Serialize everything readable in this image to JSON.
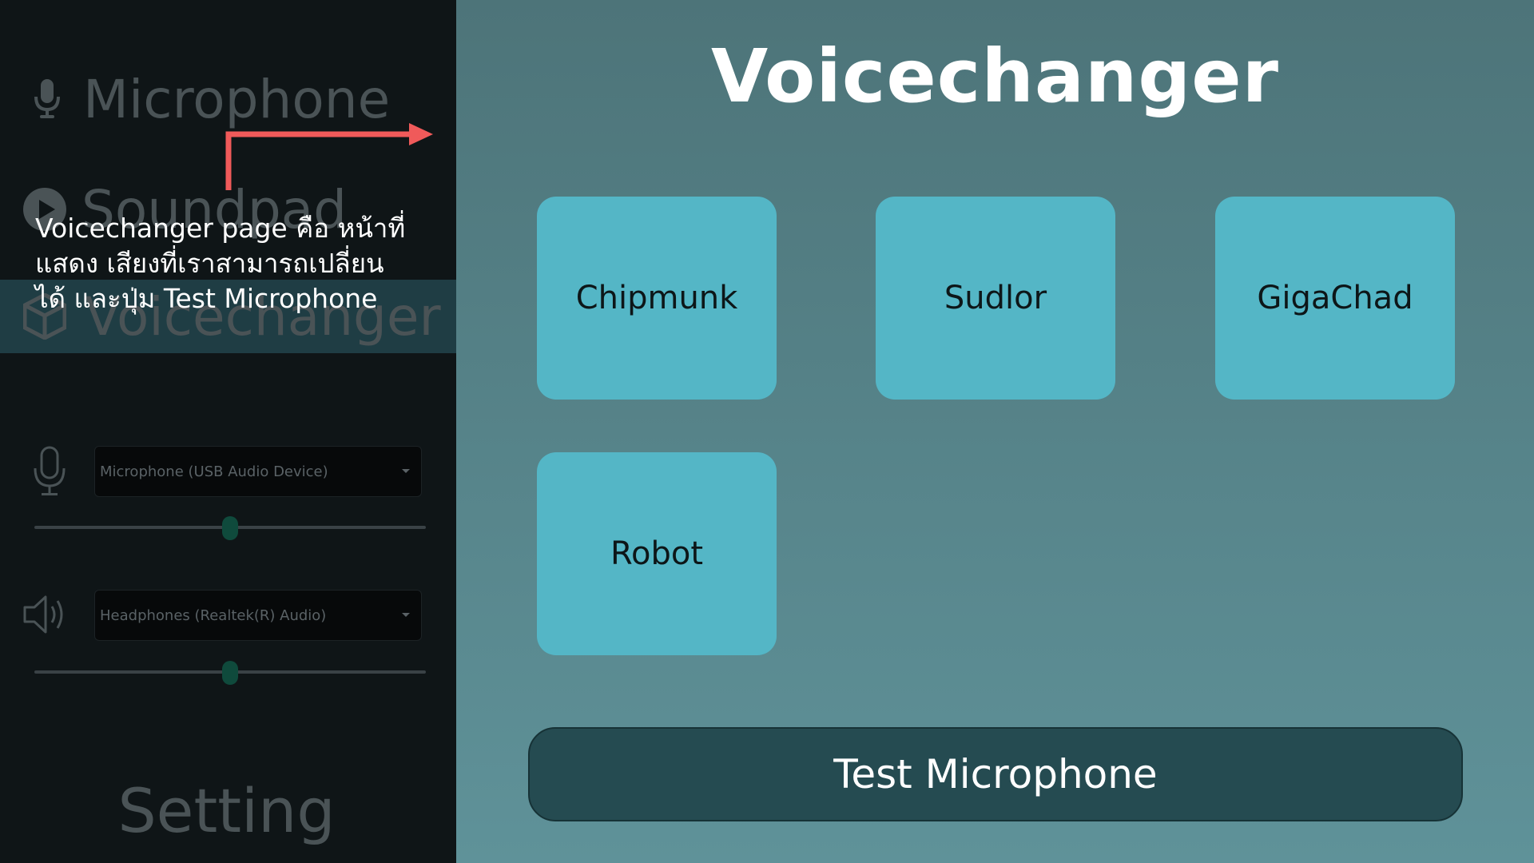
{
  "sidebar": {
    "nav": {
      "microphone": "Microphone",
      "soundpad": "Soundpad",
      "voicechanger": "Voicechanger",
      "setting": "Setting"
    },
    "active_item": "Voicechanger",
    "input_device": "Microphone (USB Audio Device)",
    "output_device": "Headphones (Realtek(R) Audio)",
    "input_volume": 0.5,
    "output_volume": 0.5
  },
  "annotation": {
    "lines": [
      "Voicechanger page คือ หน้าที่",
      "แสดง เสียงที่เราสามารถเปลี่ยน",
      "ได้ และปุ่ม Test Microphone"
    ],
    "arrow_color": "#f05a5a"
  },
  "main": {
    "title": "Voicechanger",
    "voices": [
      "Chipmunk",
      "Sudlor",
      "GigaChad",
      "Robot"
    ],
    "test_button": "Test Microphone"
  },
  "colors": {
    "card": "#54b6c6",
    "button": "#254b51",
    "slider_thumb": "#0f4a3c"
  },
  "icons": {
    "microphone": "microphone-icon",
    "soundpad": "play-circle-icon",
    "voicechanger": "cube-icon",
    "input_device": "microphone-outline-icon",
    "output_device": "speaker-icon"
  }
}
